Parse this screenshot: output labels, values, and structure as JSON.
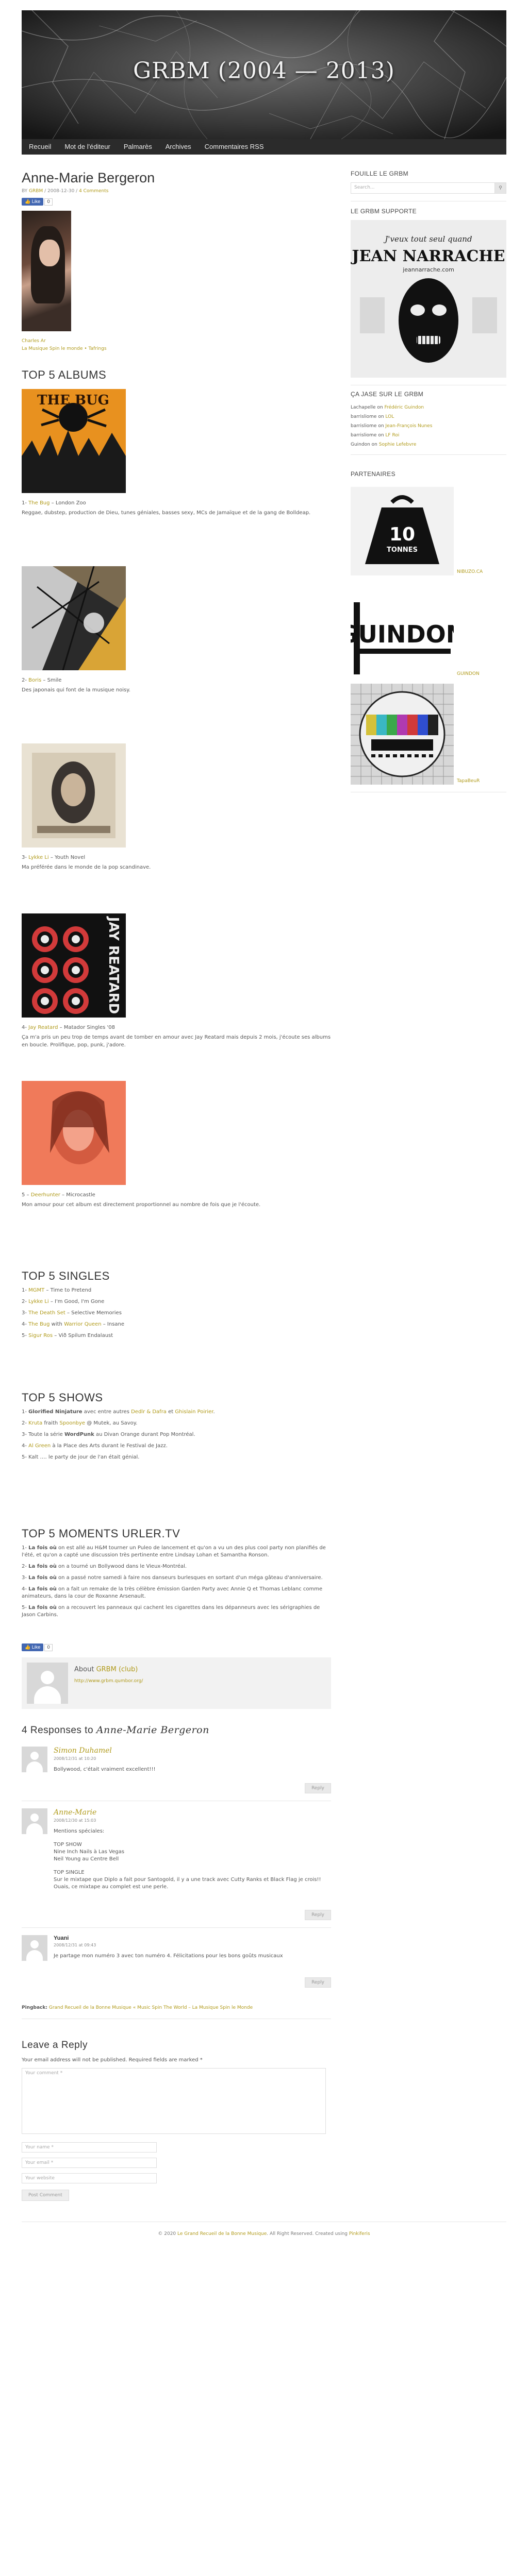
{
  "site": {
    "title": "GRBM (2004 — 2013)"
  },
  "nav": [
    "Recueil",
    "Mot de l'éditeur",
    "Palmarès",
    "Archives",
    "Commentaires RSS"
  ],
  "post": {
    "title": "Anne-Marie Bergeron",
    "meta_by": "BY",
    "meta_author": "GRBM",
    "meta_date": "2008-12-30",
    "meta_sep": " / ",
    "meta_comments": "4 Comments",
    "fb_like": "Like",
    "fb_count": "0",
    "tags_line1": "Charles Ar",
    "tags_line2": "La Musique Spin le monde • Tafrings"
  },
  "albums": {
    "heading": "TOP 5 ALBUMS",
    "items": [
      {
        "num": "1-",
        "link": "The Bug",
        "rest": " – London Zoo",
        "desc": "Reggae, dubstep, production de Dieu, tunes géniales, basses sexy, MCs de Jamaïque et de la gang de Bolldeap."
      },
      {
        "num": "2-",
        "link": "Boris",
        "rest": " – Smile",
        "desc": "Des japonais qui font de la musique noisy."
      },
      {
        "num": "3-",
        "link": "Lykke Li",
        "rest": " – Youth Novel",
        "desc": "Ma préférée dans le monde de la pop scandinave."
      },
      {
        "num": "4-",
        "link": "Jay Reatard",
        "rest": " – Matador Singles '08",
        "desc": "Ça m'a pris un peu trop de temps avant de tomber en amour avec Jay Reatard mais depuis 2 mois, j'écoute ses albums en boucle. Prolifique, pop, punk, j'adore."
      },
      {
        "num": "5 –",
        "link": "Deerhunter",
        "rest": " – Microcastle",
        "desc": "Mon amour pour cet album est directement proportionnel au nombre de fois que je l'écoute."
      }
    ]
  },
  "singles": {
    "heading": "TOP 5 SINGLES",
    "items": [
      {
        "num": "1-",
        "link": "MGMT",
        "rest": " – Time to Pretend"
      },
      {
        "num": "2-",
        "link": "Lykke Li",
        "rest": " – I'm Good, I'm Gone"
      },
      {
        "num": "3-",
        "link": "The Death Set",
        "rest": " – Selective Memories"
      },
      {
        "num": "4-",
        "link": "The Bug",
        "rest": " with ",
        "link2": "Warrior Queen",
        "rest2": " – Insane"
      },
      {
        "num": "5-",
        "link": "Sigur Ros",
        "rest": " – Við Spilum Endalaust"
      }
    ]
  },
  "shows": {
    "heading": "TOP 5 SHOWS",
    "items": [
      {
        "num": "1-",
        "pre": "",
        "bold": "Glorified Ninjature",
        "rest": " avec entre autres ",
        "link": "Dedlr & Dafra",
        "rest2": " et ",
        "link2": "Ghislain Poirier",
        "rest3": "."
      },
      {
        "num": "2-",
        "pre": "",
        "bold": "",
        "rest": "",
        "link": "Kruta",
        "rest2": " fraith ",
        "link2": "Spoonbye",
        "rest3": " @ Mutek, au Savoy."
      },
      {
        "num": "3-",
        "pre": "Toute la série ",
        "bold": "WordPunk",
        "rest": " au Divan Orange durant Pop Montréal.",
        "link": "",
        "rest2": "",
        "link2": "",
        "rest3": ""
      },
      {
        "num": "4-",
        "pre": "",
        "bold": "",
        "rest": "",
        "link": "Al Green",
        "rest2": " à la Place des Arts durant le Festival de Jazz.",
        "link2": "",
        "rest3": ""
      },
      {
        "num": "5-",
        "pre": "Kalt …. le party de jour de l'an était génial.",
        "bold": "",
        "rest": "",
        "link": "",
        "rest2": "",
        "link2": "",
        "rest3": ""
      }
    ]
  },
  "moments": {
    "heading": "TOP 5 MOMENTS URLER.TV",
    "items": [
      {
        "num": "1-",
        "bold": "La fois où",
        "rest": " on est allé au H&M tourner un Puleo de lancement et qu'on a vu un des plus cool party non planifiés de l'été, et qu'on a capté une discussion très pertinente entre Lindsay Lohan et Samantha Ronson."
      },
      {
        "num": "2-",
        "bold": "La fois où",
        "rest": " on a tourné un Bollywood dans le Vieux-Montréal."
      },
      {
        "num": "3-",
        "bold": "La fois où",
        "rest": " on a passé notre samedi à faire nos danseurs burlesques en sortant d'un méga gâteau d'anniversaire."
      },
      {
        "num": "4-",
        "bold": "La fois où",
        "rest": " on a fait un remake de la très célèbre émission Garden Party avec Annie Q et Thomas Leblanc comme animateurs, dans la cour de Roxanne Arsenault."
      },
      {
        "num": "5-",
        "bold": "La fois où",
        "rest": " on a recouvert les panneaux qui cachent les cigarettes dans les dépanneurs avec les sérigraphies de Jason Carbins."
      }
    ]
  },
  "author_box": {
    "about": "About",
    "name": "GRBM (club)",
    "url": "http://www.grbm.qumbor.org/"
  },
  "responses": {
    "count_text": "4 Responses to",
    "title": "Anne-Marie Bergeron"
  },
  "comments": [
    {
      "name": "Simon Duhamel",
      "date": "2008/12/31 at 10:20",
      "lines": [
        "Bollywood, c'était vraiment excellent!!!"
      ],
      "reply": "Reply"
    },
    {
      "name": "Anne-Marie",
      "date": "2008/12/30 at 15:03",
      "lines": [
        "Mentions spéciales:",
        "",
        "TOP SHOW",
        "Nine Inch Nails à Las Vegas",
        "Neil Young au Centre Bell",
        "",
        "TOP SINGLE",
        "Sur le mixtape que Diplo a fait pour Santogold, il y a une track avec Cutty Ranks et Black Flag je crois!! Ouais, ce mixtape au complet est une perle."
      ],
      "reply": "Reply"
    },
    {
      "name": "Yuani",
      "date": "2008/12/31 at 09:43",
      "lines": [
        "Je partage mon numéro 3 avec ton numéro 4. Félicitations pour les bons goûts musicaux"
      ],
      "reply": "Reply"
    }
  ],
  "pingback": {
    "label": "Pingback:",
    "link": "Grand Recueil de la Bonne Musique « Music Spin The World – La Musique Spin le Monde"
  },
  "reply_form": {
    "title": "Leave a Reply",
    "note": "Your email address will not be published. Required fields are marked *",
    "comment_ph": "Your comment *",
    "name_ph": "Your name *",
    "email_ph": "Your email *",
    "website_ph": "Your website",
    "submit": "Post Comment"
  },
  "sidebar": {
    "search_title": "FOUILLE LE GRBM",
    "search_ph": "Search...",
    "supports_title": "LE GRBM SUPPORTE",
    "poster_line1": "J'veux tout seul quand",
    "poster_line2": "JEAN NARRACHE",
    "poster_line3": "jeannarrache.com",
    "jase_title": "ÇA JASE SUR LE GRBM",
    "recent": [
      {
        "who": "Lachapelle",
        "on": " on ",
        "post": "Frédéric Guindon"
      },
      {
        "who": "barrisliome",
        "on": " on ",
        "post": "LOL"
      },
      {
        "who": "barrisliome",
        "on": " on ",
        "post": "Jean-François Nunes"
      },
      {
        "who": "barrisliome",
        "on": " on ",
        "post": "LF Roi"
      },
      {
        "who": "Guindon",
        "on": " on ",
        "post": "Sophie Lefebvre"
      }
    ],
    "partners_title": "PARTENAIRES",
    "partners": [
      {
        "name": "NIBUZO.CA",
        "weight": "10",
        "unit": "TONNES"
      },
      {
        "name": "GUINDON",
        "logo": "GUINDON"
      },
      {
        "name": "TapaBeuR"
      }
    ]
  },
  "footer": {
    "pre": "© 2020 ",
    "site": "Le Grand Recueil de la Bonne Musique",
    "mid": ". All Right Reserved. Created using ",
    "theme": "Pinkiferis"
  }
}
